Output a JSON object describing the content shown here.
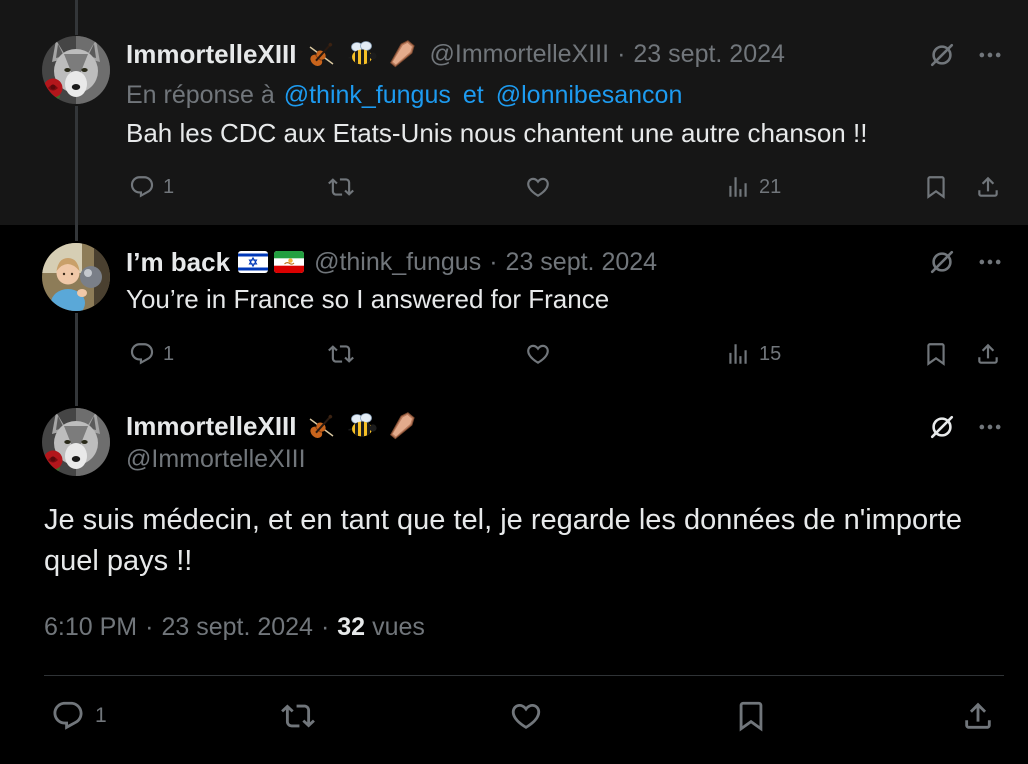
{
  "colors": {
    "background": "#000000",
    "highlight": "#161616",
    "text_primary": "#e7e9ea",
    "text_secondary": "#71767b",
    "accent": "#1d9bf0",
    "divider": "#2f3336"
  },
  "thread": {
    "replies": [
      {
        "author": {
          "name": "ImmortelleXIII",
          "handle": "@ImmortelleXIII",
          "name_icons": [
            "violin-emoji-icon",
            "bee-emoji-icon",
            "coffin-emoji-icon"
          ]
        },
        "separator": "·",
        "date": "23 sept. 2024",
        "in_reply_to": {
          "prefix": "En réponse à",
          "mentions": [
            "@think_fungus",
            "@lonnibesancon"
          ],
          "joiner": "et"
        },
        "text": "Bah les CDC aux Etats-Unis nous chantent une autre chanson !!",
        "metrics": {
          "replies": "1",
          "views": "21"
        }
      },
      {
        "author": {
          "name": "I’m back",
          "handle": "@think_fungus",
          "name_icons": [
            "israel-flag-icon",
            "iran-lion-and-sun-flag-icon"
          ]
        },
        "separator": "·",
        "date": "23 sept. 2024",
        "text": "You’re in France so I answered for France",
        "metrics": {
          "replies": "1",
          "views": "15"
        }
      }
    ],
    "focused_tweet": {
      "author": {
        "name": "ImmortelleXIII",
        "handle": "@ImmortelleXIII",
        "name_icons": [
          "violin-emoji-icon",
          "bee-emoji-icon",
          "coffin-emoji-icon"
        ]
      },
      "text": "Je suis médecin, et en tant que tel, je regarde les données de n'importe quel pays !!",
      "time": "6:10 PM",
      "separator": "·",
      "date": "23 sept. 2024",
      "views_count": "32",
      "views_label": "vues",
      "metrics": {
        "replies": "1"
      }
    }
  }
}
